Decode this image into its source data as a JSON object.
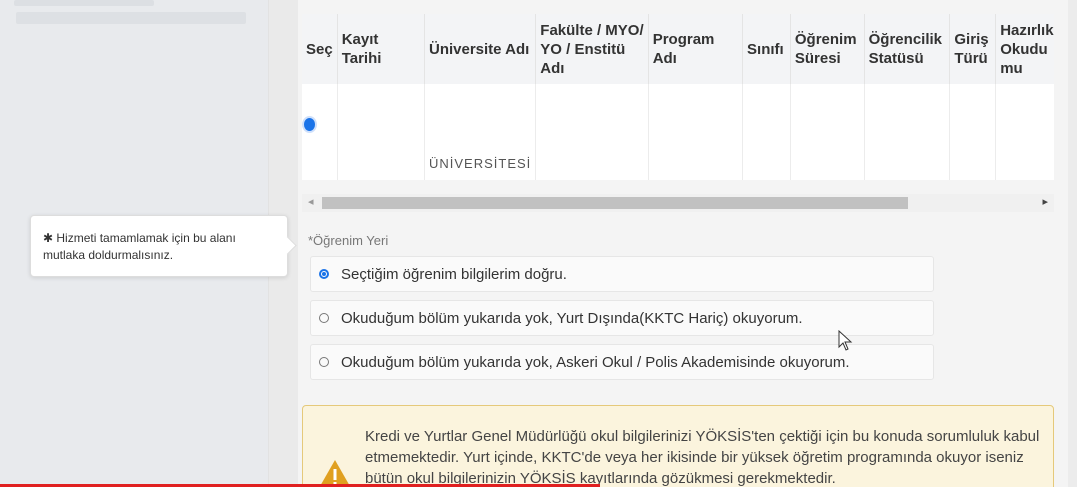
{
  "table": {
    "headers": [
      "Seç",
      "Kayıt Tarihi",
      "Üniversite Adı",
      "Fakülte / MYO/ YO / Enstitü Adı",
      "Program Adı",
      "Sınıfı",
      "Öğrenim Süresi",
      "Öğrencilik Statüsü",
      "Giriş Türü",
      "Hazırlık Okudu mu"
    ],
    "row_text_university": "ÜNİVERSİTESİ"
  },
  "form": {
    "field_label": "*Öğrenim Yeri",
    "options": [
      {
        "label": "Seçtiğim öğrenim bilgilerim doğru.",
        "selected": true
      },
      {
        "label": "Okuduğum bölüm yukarıda yok, Yurt Dışında(KKTC Hariç) okuyorum.",
        "selected": false
      },
      {
        "label": "Okuduğum bölüm yukarıda yok, Askeri Okul / Polis Akademisinde okuyorum.",
        "selected": false
      }
    ]
  },
  "tooltip": {
    "text": "✱ Hizmeti tamamlamak için bu alanı mutlaka doldurmalısınız."
  },
  "warning": {
    "icon": "warning-triangle-icon",
    "text": "Kredi ve Yurtlar Genel Müdürlüğü okul bilgilerinizi YÖKSİS'ten çektiği için bu konuda sorumluluk kabul etmemektedir. Yurt içinde, KKTC'de veya her ikisinde bir yüksek öğretim programında okuyor iseniz bütün okul bilgilerinizin YÖKSİS kayıtlarında gözükmesi gerekmektedir."
  },
  "colors": {
    "accent": "#1a73e8",
    "warning_bg": "#fbf4dd",
    "warning_border": "#e5c97a",
    "warning_icon": "#e0a020"
  }
}
